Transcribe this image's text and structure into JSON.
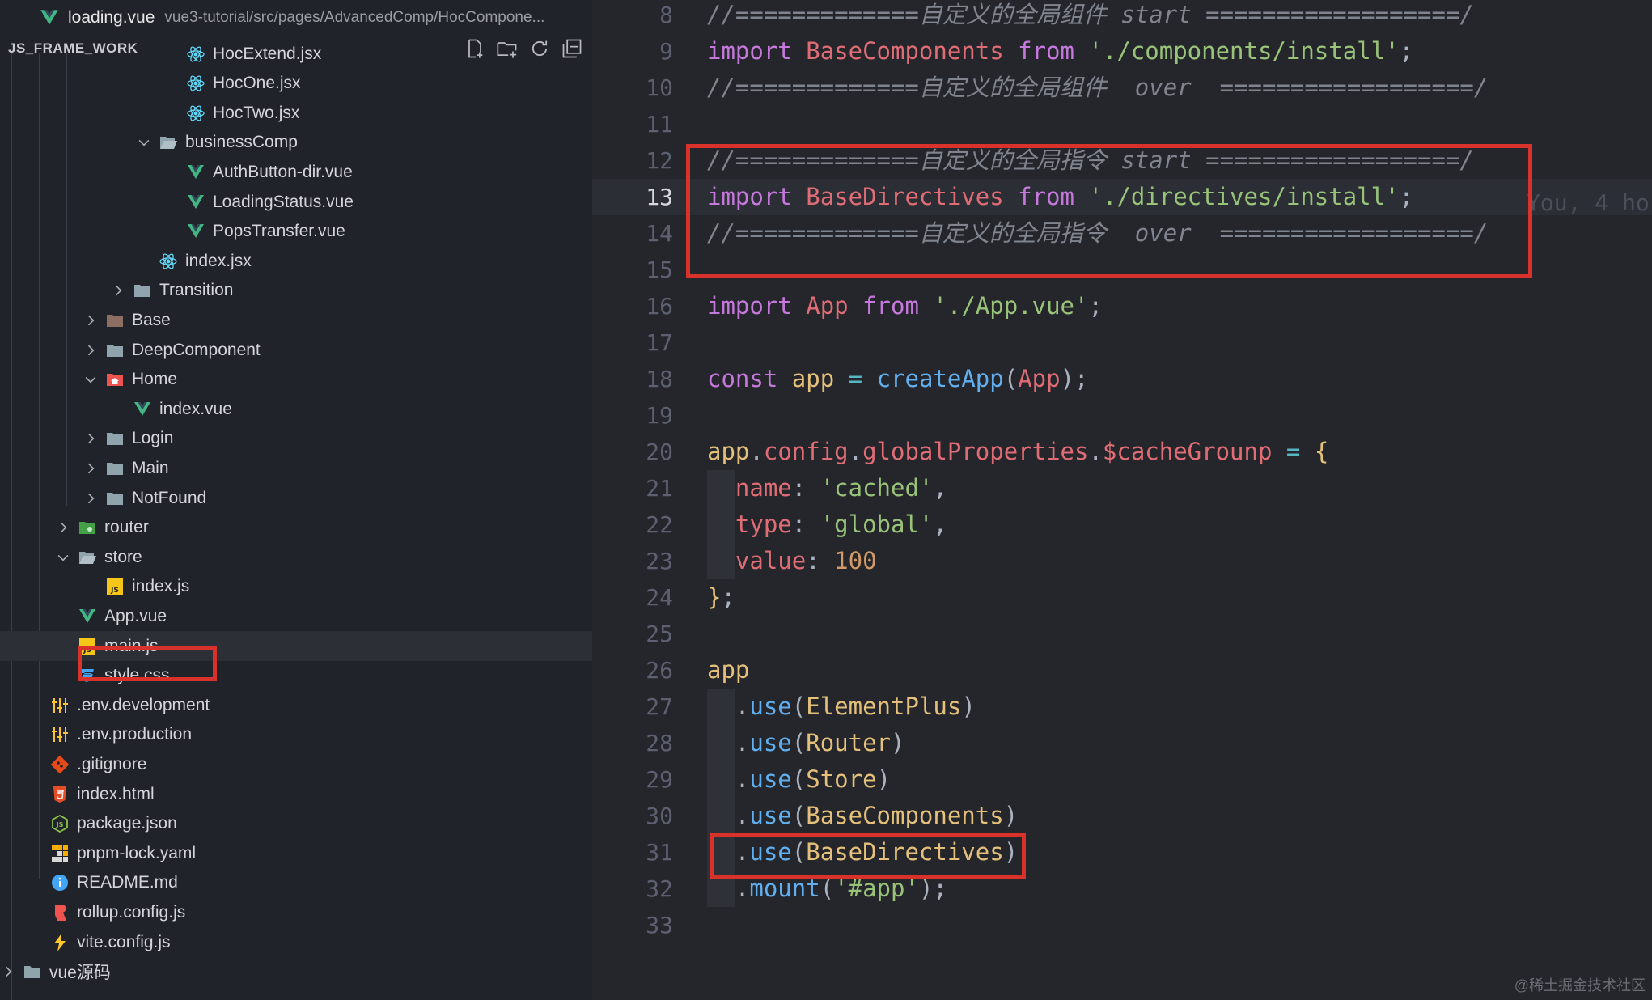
{
  "tab": {
    "title": "loading.vue",
    "path": "vue3-tutorial/src/pages/AdvancedComp/HocCompone..."
  },
  "explorer": {
    "title": "JS_FRAME_WORK"
  },
  "tree": [
    {
      "label": "HocExtend.jsx",
      "icon": "react-icon",
      "indent": 236,
      "chev": "none"
    },
    {
      "label": "HocOne.jsx",
      "icon": "react-icon",
      "indent": 236,
      "chev": "none"
    },
    {
      "label": "HocTwo.jsx",
      "icon": "react-icon",
      "indent": 236,
      "chev": "none"
    },
    {
      "label": "businessComp",
      "icon": "folder-open-icon",
      "indent": 202,
      "chev": "down"
    },
    {
      "label": "AuthButton-dir.vue",
      "icon": "vue-icon",
      "indent": 236,
      "chev": "none"
    },
    {
      "label": "LoadingStatus.vue",
      "icon": "vue-icon",
      "indent": 236,
      "chev": "none"
    },
    {
      "label": "PopsTransfer.vue",
      "icon": "vue-icon",
      "indent": 236,
      "chev": "none"
    },
    {
      "label": "index.jsx",
      "icon": "react-icon",
      "indent": 202,
      "chev": "none"
    },
    {
      "label": "Transition",
      "icon": "folder-icon",
      "indent": 170,
      "chev": "right"
    },
    {
      "label": "Base",
      "icon": "folder-base-icon",
      "indent": 136,
      "chev": "right"
    },
    {
      "label": "DeepComponent",
      "icon": "folder-icon",
      "indent": 136,
      "chev": "right"
    },
    {
      "label": "Home",
      "icon": "folder-home-icon",
      "indent": 136,
      "chev": "down"
    },
    {
      "label": "index.vue",
      "icon": "vue-icon",
      "indent": 170,
      "chev": "none"
    },
    {
      "label": "Login",
      "icon": "folder-icon",
      "indent": 136,
      "chev": "right"
    },
    {
      "label": "Main",
      "icon": "folder-icon",
      "indent": 136,
      "chev": "right"
    },
    {
      "label": "NotFound",
      "icon": "folder-icon",
      "indent": 136,
      "chev": "right"
    },
    {
      "label": "router",
      "icon": "folder-router-icon",
      "indent": 102,
      "chev": "right"
    },
    {
      "label": "store",
      "icon": "folder-open-icon",
      "indent": 102,
      "chev": "down"
    },
    {
      "label": "index.js",
      "icon": "js-icon",
      "indent": 136,
      "chev": "none"
    },
    {
      "label": "App.vue",
      "icon": "vue-icon",
      "indent": 102,
      "chev": "none"
    },
    {
      "label": "main.js",
      "icon": "js-icon",
      "indent": 102,
      "chev": "none",
      "selected": true
    },
    {
      "label": "style.css",
      "icon": "css-icon",
      "indent": 102,
      "chev": "none"
    },
    {
      "label": ".env.development",
      "icon": "env-icon",
      "indent": 68,
      "chev": "none"
    },
    {
      "label": ".env.production",
      "icon": "env-icon",
      "indent": 68,
      "chev": "none"
    },
    {
      "label": ".gitignore",
      "icon": "git-icon",
      "indent": 68,
      "chev": "none"
    },
    {
      "label": "index.html",
      "icon": "html-icon",
      "indent": 68,
      "chev": "none"
    },
    {
      "label": "package.json",
      "icon": "node-icon",
      "indent": 68,
      "chev": "none"
    },
    {
      "label": "pnpm-lock.yaml",
      "icon": "pnpm-icon",
      "indent": 68,
      "chev": "none"
    },
    {
      "label": "README.md",
      "icon": "info-icon",
      "indent": 68,
      "chev": "none"
    },
    {
      "label": "rollup.config.js",
      "icon": "rollup-icon",
      "indent": 68,
      "chev": "none"
    },
    {
      "label": "vite.config.js",
      "icon": "vite-icon",
      "indent": 68,
      "chev": "none"
    },
    {
      "label": "vue源码",
      "icon": "folder-icon",
      "indent": 34,
      "chev": "right"
    }
  ],
  "editor": {
    "current_line": 13,
    "blame": "You, 4 ho",
    "lines": [
      {
        "num": 8,
        "tokens": [
          [
            "c",
            "//=============自定义的全局组件 start ==================/"
          ]
        ]
      },
      {
        "num": 9,
        "tokens": [
          [
            "k",
            "import"
          ],
          [
            "p",
            " "
          ],
          [
            "v",
            "BaseComponents"
          ],
          [
            "p",
            " "
          ],
          [
            "k",
            "from"
          ],
          [
            "p",
            " "
          ],
          [
            "s",
            "'./components/install'"
          ],
          [
            "p",
            ";"
          ]
        ]
      },
      {
        "num": 10,
        "tokens": [
          [
            "c",
            "//=============自定义的全局组件  over  ==================/"
          ]
        ]
      },
      {
        "num": 11,
        "tokens": []
      },
      {
        "num": 12,
        "tokens": [
          [
            "c",
            "//=============自定义的全局指令 start ==================/"
          ]
        ]
      },
      {
        "num": 13,
        "tokens": [
          [
            "k",
            "import"
          ],
          [
            "p",
            " "
          ],
          [
            "v",
            "BaseDirectives"
          ],
          [
            "p",
            " "
          ],
          [
            "k",
            "from"
          ],
          [
            "p",
            " "
          ],
          [
            "s",
            "'./directives/install'"
          ],
          [
            "p",
            ";"
          ]
        ]
      },
      {
        "num": 14,
        "tokens": [
          [
            "c",
            "//=============自定义的全局指令  over  ==================/"
          ]
        ]
      },
      {
        "num": 15,
        "tokens": []
      },
      {
        "num": 16,
        "tokens": [
          [
            "k",
            "import"
          ],
          [
            "p",
            " "
          ],
          [
            "v",
            "App"
          ],
          [
            "p",
            " "
          ],
          [
            "k",
            "from"
          ],
          [
            "p",
            " "
          ],
          [
            "s",
            "'./App.vue'"
          ],
          [
            "p",
            ";"
          ]
        ]
      },
      {
        "num": 17,
        "tokens": []
      },
      {
        "num": 18,
        "tokens": [
          [
            "k",
            "const"
          ],
          [
            "p",
            " "
          ],
          [
            "t",
            "app"
          ],
          [
            "p",
            " "
          ],
          [
            "o",
            "="
          ],
          [
            "p",
            " "
          ],
          [
            "f",
            "createApp"
          ],
          [
            "p",
            "("
          ],
          [
            "v",
            "App"
          ],
          [
            "p",
            "​);"
          ]
        ]
      },
      {
        "num": 19,
        "tokens": []
      },
      {
        "num": 20,
        "tokens": [
          [
            "t",
            "app"
          ],
          [
            "p",
            "."
          ],
          [
            "v",
            "config"
          ],
          [
            "p",
            "."
          ],
          [
            "v",
            "globalProperties"
          ],
          [
            "p",
            "."
          ],
          [
            "v",
            "$cacheGrounp"
          ],
          [
            "p",
            " "
          ],
          [
            "o",
            "="
          ],
          [
            "p",
            " "
          ],
          [
            "t",
            "{"
          ]
        ]
      },
      {
        "num": 21,
        "tokens": [
          [
            "p",
            "  "
          ],
          [
            "v",
            "name"
          ],
          [
            "p",
            ": "
          ],
          [
            "s",
            "'cached'"
          ],
          [
            "p",
            ","
          ]
        ]
      },
      {
        "num": 22,
        "tokens": [
          [
            "p",
            "  "
          ],
          [
            "v",
            "type"
          ],
          [
            "p",
            ": "
          ],
          [
            "s",
            "'global'"
          ],
          [
            "p",
            ","
          ]
        ]
      },
      {
        "num": 23,
        "tokens": [
          [
            "p",
            "  "
          ],
          [
            "v",
            "value"
          ],
          [
            "p",
            ": "
          ],
          [
            "n",
            "100"
          ]
        ]
      },
      {
        "num": 24,
        "tokens": [
          [
            "t",
            "}"
          ],
          [
            "p",
            ";"
          ]
        ]
      },
      {
        "num": 25,
        "tokens": []
      },
      {
        "num": 26,
        "tokens": [
          [
            "t",
            "app"
          ]
        ]
      },
      {
        "num": 27,
        "tokens": [
          [
            "p",
            "  ."
          ],
          [
            "f",
            "use"
          ],
          [
            "p",
            "("
          ],
          [
            "t",
            "ElementPlus"
          ],
          [
            "p",
            ")"
          ]
        ]
      },
      {
        "num": 28,
        "tokens": [
          [
            "p",
            "  ."
          ],
          [
            "f",
            "use"
          ],
          [
            "p",
            "("
          ],
          [
            "t",
            "Router"
          ],
          [
            "p",
            ")"
          ]
        ]
      },
      {
        "num": 29,
        "tokens": [
          [
            "p",
            "  ."
          ],
          [
            "f",
            "use"
          ],
          [
            "p",
            "("
          ],
          [
            "t",
            "Store"
          ],
          [
            "p",
            ")"
          ]
        ]
      },
      {
        "num": 30,
        "tokens": [
          [
            "p",
            "  ."
          ],
          [
            "f",
            "use"
          ],
          [
            "p",
            "("
          ],
          [
            "t",
            "BaseComponents"
          ],
          [
            "p",
            ")"
          ]
        ]
      },
      {
        "num": 31,
        "tokens": [
          [
            "p",
            "  ."
          ],
          [
            "f",
            "use"
          ],
          [
            "p",
            "("
          ],
          [
            "t",
            "BaseDirectives"
          ],
          [
            "p",
            ")"
          ]
        ]
      },
      {
        "num": 32,
        "tokens": [
          [
            "p",
            "  ."
          ],
          [
            "f",
            "mount"
          ],
          [
            "p",
            "("
          ],
          [
            "s",
            "'#app'"
          ],
          [
            "p",
            "​);"
          ]
        ]
      },
      {
        "num": 33,
        "tokens": []
      }
    ]
  },
  "watermark": "@稀土掘金技术社区",
  "colors": {
    "highlight_box": "#d8322b",
    "sidebar_bg": "#21232a",
    "editor_bg": "#24262b"
  }
}
